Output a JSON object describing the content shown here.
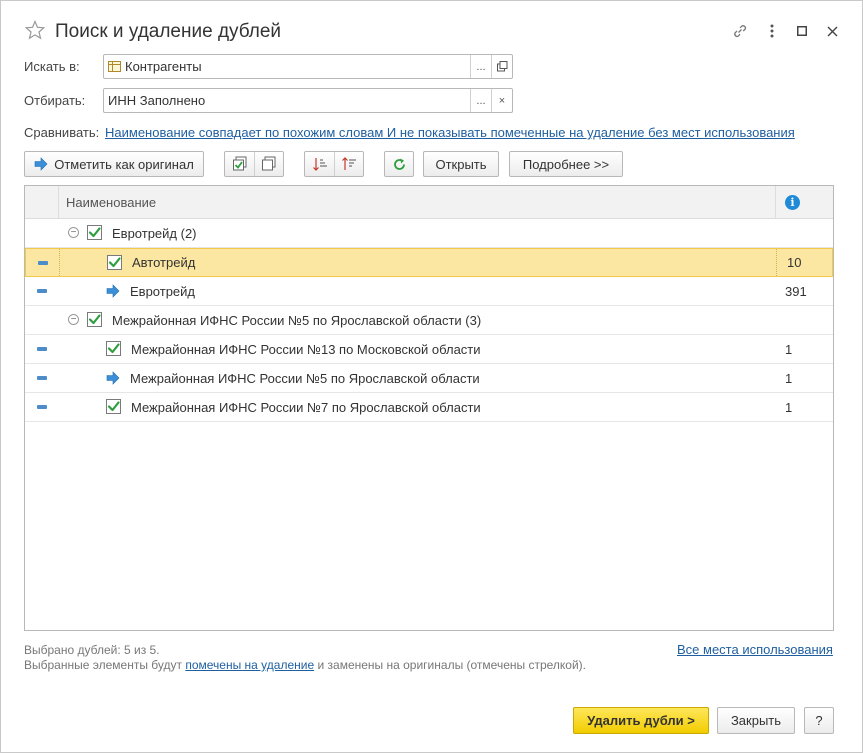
{
  "window": {
    "title": "Поиск и удаление дублей"
  },
  "form": {
    "search_label": "Искать в:",
    "search_value": "Контрагенты",
    "search_btn_more": "...",
    "filter_label": "Отбирать:",
    "filter_value": "ИНН Заполнено",
    "filter_btn_more": "...",
    "filter_btn_clear": "×",
    "compare_label": "Сравнивать:",
    "compare_link": "Наименование совпадает по похожим словам И не показывать помеченные на удаление без мест использования"
  },
  "toolbar": {
    "mark_original": "Отметить как оригинал",
    "open": "Открыть",
    "details": "Подробнее >>"
  },
  "grid": {
    "header_name": "Наименование",
    "header_info": "i",
    "rows": [
      {
        "type": "group",
        "name": "Евротрейд (2)",
        "count": ""
      },
      {
        "type": "dup",
        "name": "Автотрейд",
        "count": "10"
      },
      {
        "type": "orig",
        "name": "Евротрейд",
        "count": "391"
      },
      {
        "type": "group",
        "name": "Межрайонная ИФНС России №5 по Ярославской области (3)",
        "count": ""
      },
      {
        "type": "dup",
        "name": "Межрайонная ИФНС России №13 по Московской области",
        "count": "1"
      },
      {
        "type": "orig",
        "name": "Межрайонная ИФНС России №5 по Ярославской области",
        "count": "1"
      },
      {
        "type": "dup",
        "name": "Межрайонная ИФНС России №7 по Ярославской области",
        "count": "1"
      }
    ]
  },
  "footer": {
    "selected_count": "Выбрано дублей: 5 из 5.",
    "note_before": "Выбранные элементы будут ",
    "note_link": "помечены на удаление",
    "note_after": " и заменены на оригиналы (отмечены стрелкой).",
    "all_places": "Все места использования"
  },
  "buttons": {
    "delete": "Удалить дубли >",
    "close": "Закрыть",
    "help": "?"
  },
  "colors": {
    "accent_yellow": "#f2cc00",
    "selected_row": "#fbe7a1",
    "link": "#1f5fa0",
    "check_green": "#2e9e3e",
    "arrow_blue": "#3a8fd8"
  }
}
